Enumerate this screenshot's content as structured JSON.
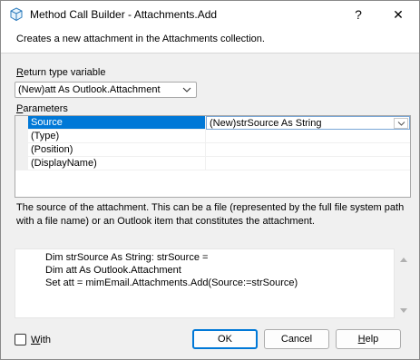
{
  "window": {
    "title": "Method Call Builder - Attachments.Add",
    "help_glyph": "?",
    "close_glyph": "✕"
  },
  "description": "Creates a new attachment in the Attachments collection.",
  "return_type": {
    "label_access": "R",
    "label_rest": "eturn type variable",
    "selected": "(New)att As Outlook.Attachment"
  },
  "parameters": {
    "label_access": "P",
    "label_rest": "arameters",
    "rows": [
      {
        "name": "Source",
        "value": "(New)strSource As String"
      },
      {
        "name": "(Type)",
        "value": ""
      },
      {
        "name": "(Position)",
        "value": ""
      },
      {
        "name": "(DisplayName)",
        "value": ""
      }
    ]
  },
  "help_text": "The source of the attachment. This can be a file (represented by the full file system path with a file name) or an Outlook item that constitutes the attachment.",
  "code_lines": [
    "Dim strSource As String: strSource =",
    "Dim att As Outlook.Attachment",
    "Set att = mimEmail.Attachments.Add(Source:=strSource)"
  ],
  "with_checkbox": {
    "access": "W",
    "rest": "ith",
    "checked": false
  },
  "buttons": {
    "ok": "OK",
    "cancel": "Cancel",
    "help_access": "H",
    "help_rest": "elp"
  },
  "colors": {
    "selection": "#0078d7",
    "dialog_bg": "#f0f0f0"
  }
}
